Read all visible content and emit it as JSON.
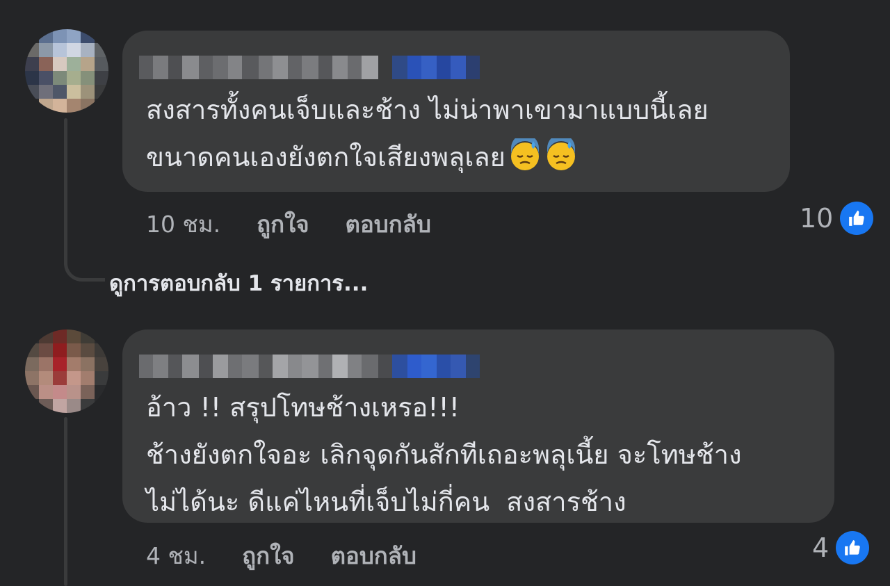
{
  "comments": [
    {
      "text_lines": [
        "สงสารทั้งคนเจ็บและช้าง ไม่น่าพาเขามาแบบนี้เลย",
        "ขนาดคนเองยังตกใจเสียงพลุเลย"
      ],
      "emojis": [
        "downcast-face-with-sweat",
        "downcast-face-with-sweat"
      ],
      "time": "10 ชม.",
      "like_label": "ถูกใจ",
      "reply_label": "ตอบกลับ",
      "reaction_count": "10",
      "reaction_icon": "thumbs-up-icon"
    },
    {
      "text_lines": [
        "อ้าว !! สรุปโทษช้างเหรอ!!!",
        "ช้างยังตกใจอะ เลิกจุดกันสักทีเถอะพลุเนี้ย จะโทษช้าง",
        "ไม่ได้นะ ดีแค่ไหนที่เจ็บไม่กี่คน  สงสารช้าง"
      ],
      "emojis": [],
      "time": "4 ชม.",
      "like_label": "ถูกใจ",
      "reply_label": "ตอบกลับ",
      "reaction_count": "4",
      "reaction_icon": "thumbs-up-icon"
    }
  ],
  "view_replies_label": "ดูการตอบกลับ 1 รายการ...",
  "colors": {
    "background": "#242527",
    "bubble": "#3a3b3c",
    "text": "#e4e6eb",
    "muted": "#b0b3b8",
    "like_blue": "#1877f2"
  }
}
